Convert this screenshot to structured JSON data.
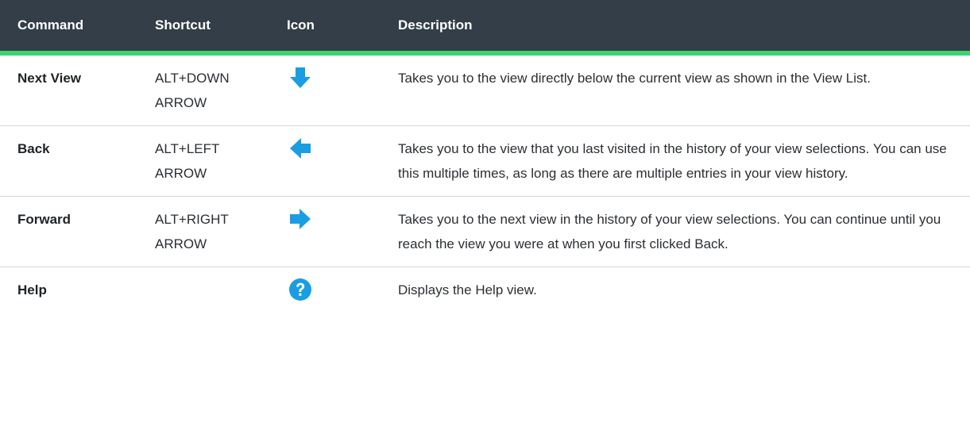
{
  "header": {
    "command": "Command",
    "shortcut": "Shortcut",
    "icon": "Icon",
    "description": "Description"
  },
  "colors": {
    "header_bg": "#333e48",
    "header_accent": "#3dd56d",
    "icon_blue": "#1a9ee1"
  },
  "rows": [
    {
      "command": "Next View",
      "shortcut": "ALT+DOWN ARROW",
      "icon": "arrow-down-icon",
      "description": "Takes you to the view directly below the current view as shown in the View List."
    },
    {
      "command": "Back",
      "shortcut": "ALT+LEFT ARROW",
      "icon": "arrow-left-icon",
      "description": "Takes you to the view that you last visited in the history of your view selections. You can use this multiple times, as long as there are multiple entries in your view history."
    },
    {
      "command": "Forward",
      "shortcut": "ALT+RIGHT ARROW",
      "icon": "arrow-right-icon",
      "description": "Takes you to the next view in the history of your view selections. You can continue until you reach the view you were at when you first clicked Back."
    },
    {
      "command": "Help",
      "shortcut": "",
      "icon": "help-icon",
      "description": "Displays the Help view."
    }
  ]
}
